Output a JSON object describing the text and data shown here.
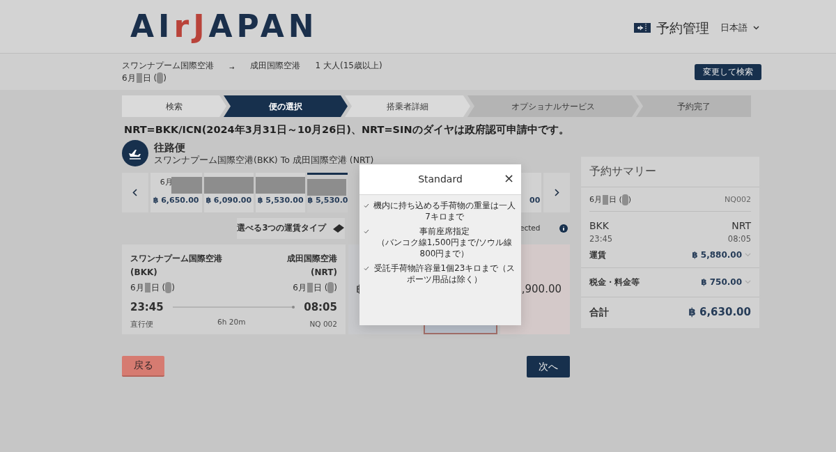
{
  "header": {
    "logo": [
      {
        "text": "AI",
        "accent": false
      },
      {
        "text": "rJ",
        "accent": true
      },
      {
        "text": "APAN",
        "accent": false
      }
    ],
    "manage_link": "予約管理",
    "language": "日本語"
  },
  "search_summary": {
    "origin": "スワンナプーム国際空港",
    "date": {
      "month": "6月",
      "day": "日 (",
      "end": ")"
    },
    "arrow": "→",
    "destination": "成田国際空港",
    "passengers": "1 大人(15歳以上)",
    "button": "変更して検索"
  },
  "steps": [
    {
      "label": "検索",
      "selected": false,
      "enabled": true
    },
    {
      "label": "便の選択",
      "selected": true,
      "enabled": true
    },
    {
      "label": "搭乗者詳細",
      "selected": false,
      "enabled": true
    },
    {
      "label": "オプショナルサービス",
      "selected": false,
      "enabled": false
    },
    {
      "label": "予約完了",
      "selected": false,
      "enabled": false
    }
  ],
  "notice": "NRT=BKK/ICN(2024年3月31日～10月26日)、NRT=SINのダイヤは政府認可申請中です。",
  "outbound": {
    "title": "往路便",
    "route": "スワンナプーム国際空港(BKK) To 成田国際空港 (NRT)"
  },
  "date_tabs": [
    {
      "label": "6月",
      "price": "฿ 6,650.00",
      "selected": false
    },
    {
      "price": "฿ 6,090.00",
      "selected": false
    },
    {
      "price": "฿ 5,530.00",
      "selected": false
    },
    {
      "price": "฿ 5,530.0",
      "selected": true
    },
    {
      "price": "00",
      "selected": false
    }
  ],
  "fare_header": {
    "title": "選べる3つの運賃タイプ",
    "column_3": "ected"
  },
  "flight": {
    "origin": "スワンナプーム国際空港",
    "origin_code": "(BKK)",
    "destination": "成田国際空港",
    "destination_code": "(NRT)",
    "depart_date": {
      "month": "6月",
      "day": "日 (",
      "end": ")"
    },
    "arrive_date": {
      "month": "6月",
      "day": "日 (",
      "end": ")"
    },
    "depart_time": "23:45",
    "arrive_time": "08:05",
    "type": "直行便",
    "duration": "6h 20m",
    "flight_no": "NQ 002"
  },
  "fares": [
    {
      "text": "฿",
      "selected": false
    },
    {
      "selected": true
    },
    {
      "text": ",900.00",
      "selected": false
    }
  ],
  "buttons": {
    "back": "戻る",
    "next": "次へ"
  },
  "summary": {
    "title": "予約サマリー",
    "date": {
      "month": "6月",
      "day": "日 (",
      "end": ")"
    },
    "flight_no": "NQ002",
    "from": "BKK",
    "to": "NRT",
    "depart": "23:45",
    "arrive": "08:05",
    "rows": [
      {
        "label": "運賃",
        "amount": "฿ 5,880.00"
      },
      {
        "label": "税金・料金等",
        "amount": "฿ 750.00"
      }
    ],
    "total_label": "合計",
    "total": "฿ 6,630.00"
  },
  "modal": {
    "title": "Standard",
    "close": "×",
    "items": [
      [
        "機内に持ち込める手荷物の重量は一人7キロまで"
      ],
      [
        "事前座席指定",
        "（バンコク線1,500円まで/ソウル線800円まで）"
      ],
      [
        "受託手荷物許容量1個23キロまで（スポーツ用品は除く）"
      ]
    ]
  }
}
